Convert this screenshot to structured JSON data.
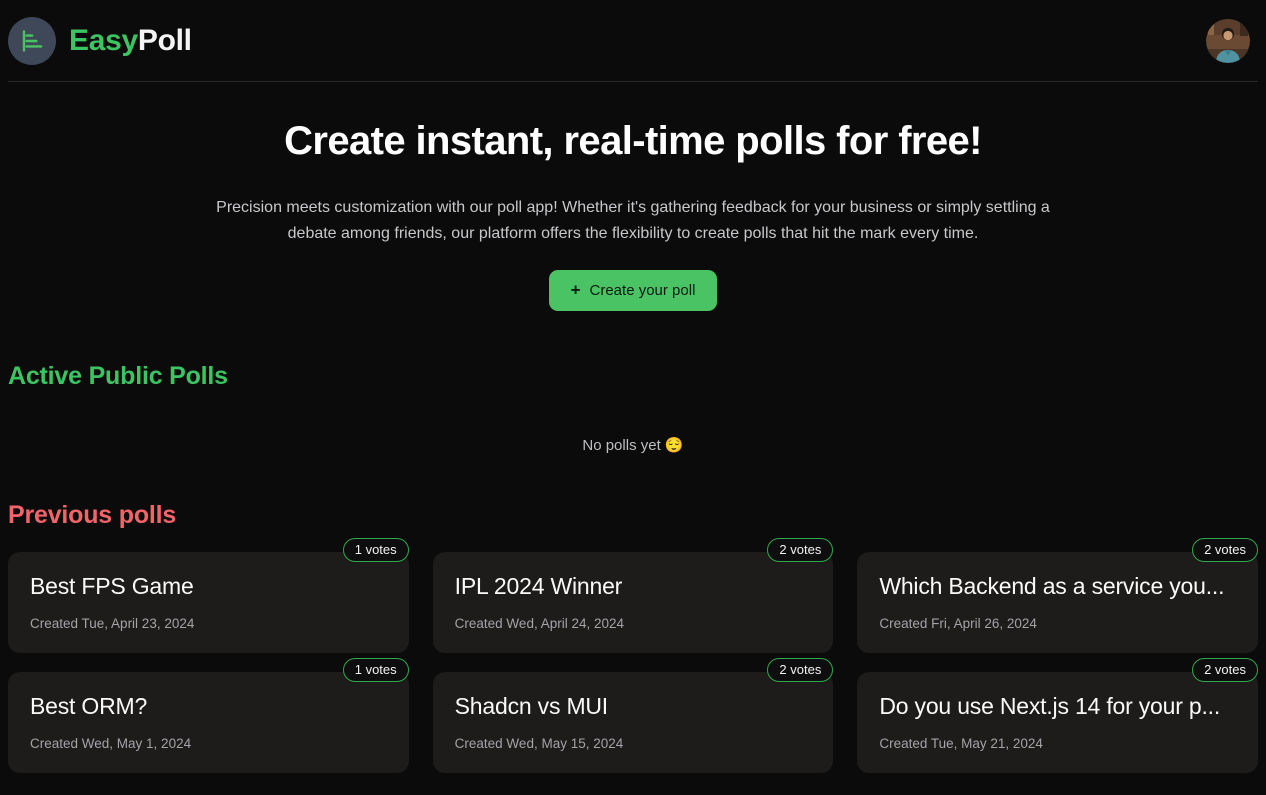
{
  "header": {
    "logo_icon": "bar-chart-logo-icon",
    "brand_primary": "Easy",
    "brand_secondary": "Poll",
    "avatar_icon": "user-avatar-photo"
  },
  "hero": {
    "title": "Create instant, real-time polls for free!",
    "description": "Precision meets customization with our poll app! Whether it's gathering feedback for your business or simply settling a debate among friends, our platform offers the flexibility to create polls that hit the mark every time.",
    "cta_icon": "plus-icon",
    "cta_label": "Create your poll"
  },
  "active_section": {
    "title": "Active Public Polls",
    "empty_text": "No polls yet",
    "empty_emoji": "😌"
  },
  "previous_section": {
    "title": "Previous polls",
    "polls": [
      {
        "title": "Best FPS Game",
        "created": "Created Tue, April 23, 2024",
        "votes": "1 votes"
      },
      {
        "title": "IPL 2024 Winner",
        "created": "Created Wed, April 24, 2024",
        "votes": "2 votes"
      },
      {
        "title": "Which Backend as a service you...",
        "created": "Created Fri, April 26, 2024",
        "votes": "2 votes"
      },
      {
        "title": "Best ORM?",
        "created": "Created Wed, May 1, 2024",
        "votes": "1 votes"
      },
      {
        "title": "Shadcn vs MUI",
        "created": "Created Wed, May 15, 2024",
        "votes": "2 votes"
      },
      {
        "title": "Do you use Next.js 14 for your p...",
        "created": "Created Tue, May 21, 2024",
        "votes": "2 votes"
      }
    ]
  },
  "colors": {
    "background": "#0b0b0b",
    "accent_green": "#3cc463",
    "cta_green": "#4ac364",
    "accent_red": "#f2636a",
    "card_background": "#1d1c1a",
    "badge_border": "#2fa84f",
    "logo_circle": "#3e4859"
  }
}
